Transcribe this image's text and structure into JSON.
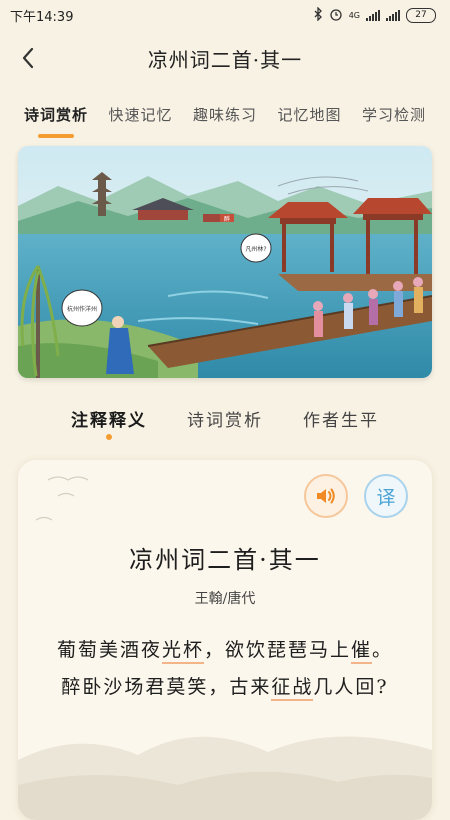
{
  "status": {
    "time": "下午14:39",
    "network": "4G",
    "battery": "27"
  },
  "nav": {
    "title": "凉州词二首·其一"
  },
  "top_tabs": [
    {
      "label": "诗词赏析"
    },
    {
      "label": "快速记忆"
    },
    {
      "label": "趣味练习"
    },
    {
      "label": "记忆地图"
    },
    {
      "label": "学习检测"
    }
  ],
  "hero": {
    "bubble_left": "杭州作洋州",
    "bubble_right": "凡州林?",
    "sign_text": "醉"
  },
  "sub_tabs": [
    {
      "label": "注释释义"
    },
    {
      "label": "诗词赏析"
    },
    {
      "label": "作者生平"
    }
  ],
  "poem": {
    "title": "凉州词二首·其一",
    "author": "王翰/唐代",
    "line1": {
      "a": "葡萄美酒夜",
      "b": "光杯",
      "c": "，欲饮琵琶马上",
      "d": "催",
      "e": "。"
    },
    "line2": {
      "a": "醉卧沙场君莫笑，古来",
      "b": "征战",
      "c": "几人回?"
    },
    "translate_label": "译"
  },
  "colors": {
    "accent": "#f39c32",
    "background": "#f8f2e4"
  }
}
